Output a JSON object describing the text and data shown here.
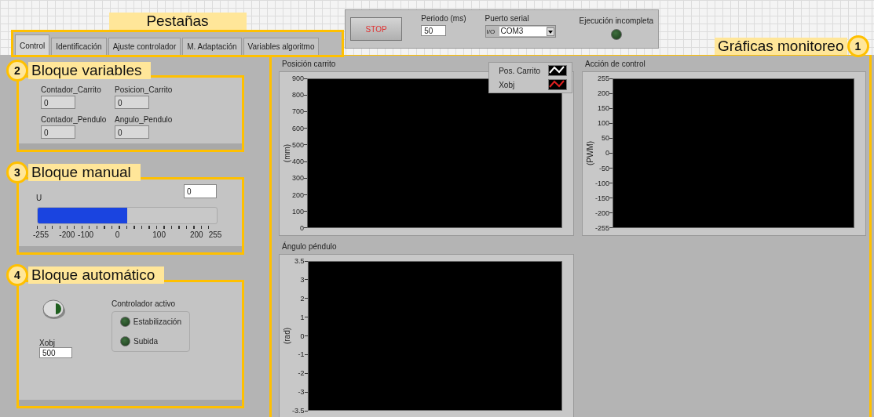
{
  "tabs_annotation": {
    "label": "Pestañas"
  },
  "tabs": [
    {
      "label": "Control",
      "selected": true
    },
    {
      "label": "Identificación",
      "selected": false
    },
    {
      "label": "Ajuste controlador",
      "selected": false
    },
    {
      "label": "M. Adaptación",
      "selected": false
    },
    {
      "label": "Variables algoritmo",
      "selected": false
    }
  ],
  "toolbar": {
    "stop_button": "STOP",
    "period": {
      "label": "Periodo (ms)",
      "value": "50"
    },
    "serial_port": {
      "label": "Puerto serial",
      "prefix": "I/O",
      "value": "COM3"
    },
    "execution": {
      "label": "Ejecución incompleta",
      "on": false
    }
  },
  "graphs_annotation": {
    "number": "1",
    "label": "Gráficas monitoreo"
  },
  "variables_block": {
    "number": "2",
    "label": "Bloque variables",
    "fields": [
      {
        "label": "Contador_Carrito",
        "value": "0"
      },
      {
        "label": "Posicion_Carrito",
        "value": "0"
      },
      {
        "label": "Contador_Pendulo",
        "value": "0"
      },
      {
        "label": "Angulo_Pendulo",
        "value": "0"
      }
    ]
  },
  "manual_block": {
    "number": "3",
    "label": "Bloque manual",
    "slider": {
      "label": "U",
      "value": "0",
      "level": 0.5,
      "scale": [
        "-255",
        "-200",
        "-100",
        "0",
        "100",
        "200",
        "255"
      ]
    }
  },
  "auto_block": {
    "number": "4",
    "label": "Bloque automático",
    "switch": {
      "on": false
    },
    "xobj": {
      "label": "Xobj",
      "value": "500"
    },
    "controller": {
      "label": "Controlador activo",
      "leds": [
        {
          "label": "Estabilización",
          "on": false
        },
        {
          "label": "Subida",
          "on": false
        }
      ]
    }
  },
  "graphs": [
    {
      "title": "Posición carrito",
      "ylabel": "(mm)",
      "yticks": [
        "900",
        "800",
        "700",
        "600",
        "500",
        "400",
        "300",
        "200",
        "100",
        "0"
      ],
      "legend": [
        {
          "name": "Pos. Carrito",
          "color": "#ffffff"
        },
        {
          "name": "Xobj",
          "color": "#e02020"
        }
      ]
    },
    {
      "title": "Acción de control",
      "ylabel": "(PWM)",
      "yticks": [
        "255",
        "200",
        "150",
        "100",
        "50",
        "0",
        "-50",
        "-100",
        "-150",
        "-200",
        "-255"
      ]
    },
    {
      "title": "Ángulo péndulo",
      "ylabel": "(rad)",
      "yticks": [
        "3.5",
        "3",
        "2",
        "1",
        "0",
        "-1",
        "-2",
        "-3",
        "-3.5"
      ]
    }
  ]
}
